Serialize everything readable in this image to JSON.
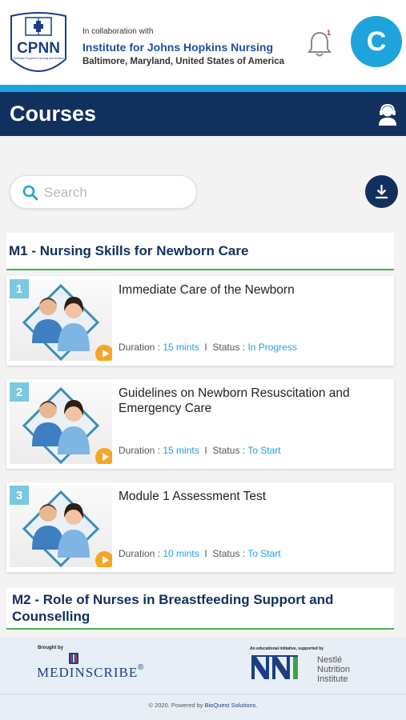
{
  "header": {
    "logo_text": "CPNN",
    "logo_subtext": "Certificate Program in Nursing and Nutrition",
    "collab_label": "In collaboration with",
    "institute": "Institute for Johns Hopkins Nursing",
    "location": "Baltimore, Maryland, United States of America",
    "notification_count": "1",
    "avatar_letter": "C"
  },
  "titlebar": {
    "title": "Courses"
  },
  "search": {
    "placeholder": "Search",
    "value": ""
  },
  "modules": [
    {
      "title": "M1 - Nursing Skills for Newborn Care",
      "courses": [
        {
          "number": "1",
          "title": "Immediate Care of the Newborn",
          "duration_label": "Duration :",
          "duration": "15 mints",
          "sep": "I",
          "status_label": "Status :",
          "status": "In Progress"
        },
        {
          "number": "2",
          "title": "Guidelines on Newborn Resuscitation and Emergency Care",
          "duration_label": "Duration :",
          "duration": "15 mints",
          "sep": "I",
          "status_label": "Status :",
          "status": "To Start"
        },
        {
          "number": "3",
          "title": "Module 1 Assessment Test",
          "duration_label": "Duration :",
          "duration": "10 mints",
          "sep": "I",
          "status_label": "Status :",
          "status": "To Start"
        }
      ]
    },
    {
      "title": "M2 - Role of Nurses in Breastfeeding Support and Counselling",
      "courses": []
    }
  ],
  "footer": {
    "brought_by": "Brought by",
    "medinscribe": "MEDINSCRIBE",
    "medinscribe_reg": "®",
    "edu_initiative": "An educational initiative, supported by",
    "nestle": "Nestlé",
    "nutrition": "Nutrition",
    "institute": "Institute",
    "copyright": "© 2020. Powered by",
    "powered_by": "BioQuest Solutions."
  },
  "colors": {
    "navy": "#11305e",
    "accent_blue": "#1ea3dc",
    "play_orange": "#f5a623",
    "module_underline": "#4caf50"
  }
}
